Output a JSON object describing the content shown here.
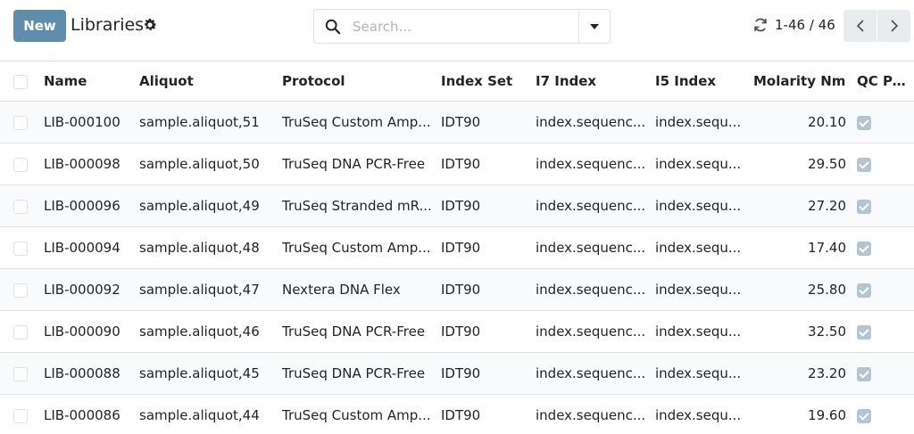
{
  "control_panel": {
    "new_button": "New",
    "title": "Libraries",
    "search_placeholder": "Search...",
    "pager_value": "1-46",
    "pager_separator": "/",
    "pager_total": "46"
  },
  "icons": {
    "settings": "gear-icon",
    "search": "search-icon",
    "toggle": "caret-down-icon",
    "refresh": "refresh-icon",
    "previous": "chevron-left-icon",
    "next": "chevron-right-icon"
  },
  "colors": {
    "primary": "#5f8ead",
    "qc_checkbox": "#b3c5d3",
    "pager_button": "#e9ecef",
    "row_border": "#dee2e6"
  },
  "table": {
    "headers": {
      "name": "Name",
      "aliquot": "Aliquot",
      "protocol": "Protocol",
      "index_set": "Index Set",
      "i7": "I7 Index",
      "i5": "I5 Index",
      "molarity": "Molarity Nm",
      "qc": "QC Pass"
    },
    "rows": [
      {
        "name": "LIB-000100",
        "aliquot": "sample.aliquot,51",
        "protocol": "TruSeq Custom Amp...",
        "index_set": "IDT90",
        "i7": "index.sequenc...",
        "i5": "index.sequ...",
        "molarity": "20.10",
        "qc": true
      },
      {
        "name": "LIB-000098",
        "aliquot": "sample.aliquot,50",
        "protocol": "TruSeq DNA PCR-Free",
        "index_set": "IDT90",
        "i7": "index.sequenc...",
        "i5": "index.sequ...",
        "molarity": "29.50",
        "qc": true
      },
      {
        "name": "LIB-000096",
        "aliquot": "sample.aliquot,49",
        "protocol": "TruSeq Stranded mR...",
        "index_set": "IDT90",
        "i7": "index.sequenc...",
        "i5": "index.sequ...",
        "molarity": "27.20",
        "qc": true
      },
      {
        "name": "LIB-000094",
        "aliquot": "sample.aliquot,48",
        "protocol": "TruSeq Custom Amp...",
        "index_set": "IDT90",
        "i7": "index.sequenc...",
        "i5": "index.sequ...",
        "molarity": "17.40",
        "qc": true
      },
      {
        "name": "LIB-000092",
        "aliquot": "sample.aliquot,47",
        "protocol": "Nextera DNA Flex",
        "index_set": "IDT90",
        "i7": "index.sequenc...",
        "i5": "index.sequ...",
        "molarity": "25.80",
        "qc": true
      },
      {
        "name": "LIB-000090",
        "aliquot": "sample.aliquot,46",
        "protocol": "TruSeq DNA PCR-Free",
        "index_set": "IDT90",
        "i7": "index.sequenc...",
        "i5": "index.sequ...",
        "molarity": "32.50",
        "qc": true
      },
      {
        "name": "LIB-000088",
        "aliquot": "sample.aliquot,45",
        "protocol": "TruSeq DNA PCR-Free",
        "index_set": "IDT90",
        "i7": "index.sequenc...",
        "i5": "index.sequ...",
        "molarity": "23.20",
        "qc": true
      },
      {
        "name": "LIB-000086",
        "aliquot": "sample.aliquot,44",
        "protocol": "TruSeq Custom Amp...",
        "index_set": "IDT90",
        "i7": "index.sequenc...",
        "i5": "index.sequ...",
        "molarity": "19.60",
        "qc": true
      }
    ]
  }
}
